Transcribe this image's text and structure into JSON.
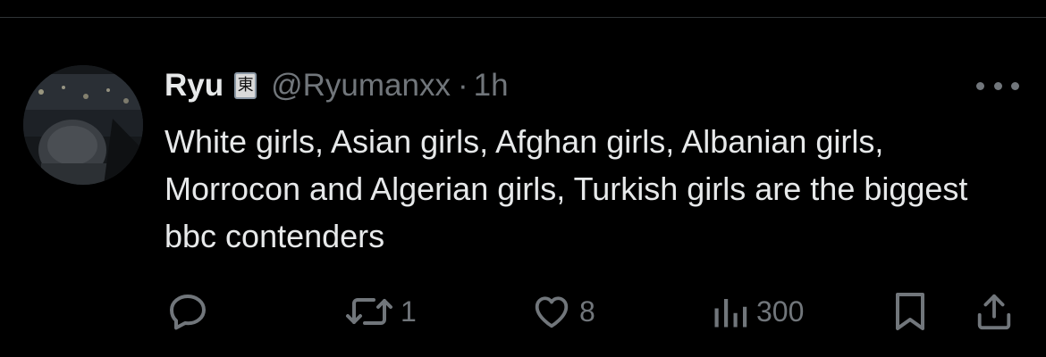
{
  "tweet": {
    "display_name": "Ryu",
    "badge_glyph": "東",
    "handle": "@Ryumanxx",
    "separator": "·",
    "time": "1h",
    "text": "White girls, Asian girls, Afghan girls, Albanian girls, Morrocon and Algerian girls, Turkish girls are the biggest bbc contenders"
  },
  "actions": {
    "reply_icon": "reply-icon",
    "retweet_icon": "retweet-icon",
    "retweet_count": "1",
    "like_icon": "heart-icon",
    "like_count": "8",
    "views_icon": "views-icon",
    "views_count": "300",
    "bookmark_icon": "bookmark-icon",
    "share_icon": "share-icon"
  },
  "colors": {
    "background": "#000000",
    "primary_text": "#e7e9ea",
    "secondary_text": "#71767b",
    "divider": "#2f3336"
  }
}
